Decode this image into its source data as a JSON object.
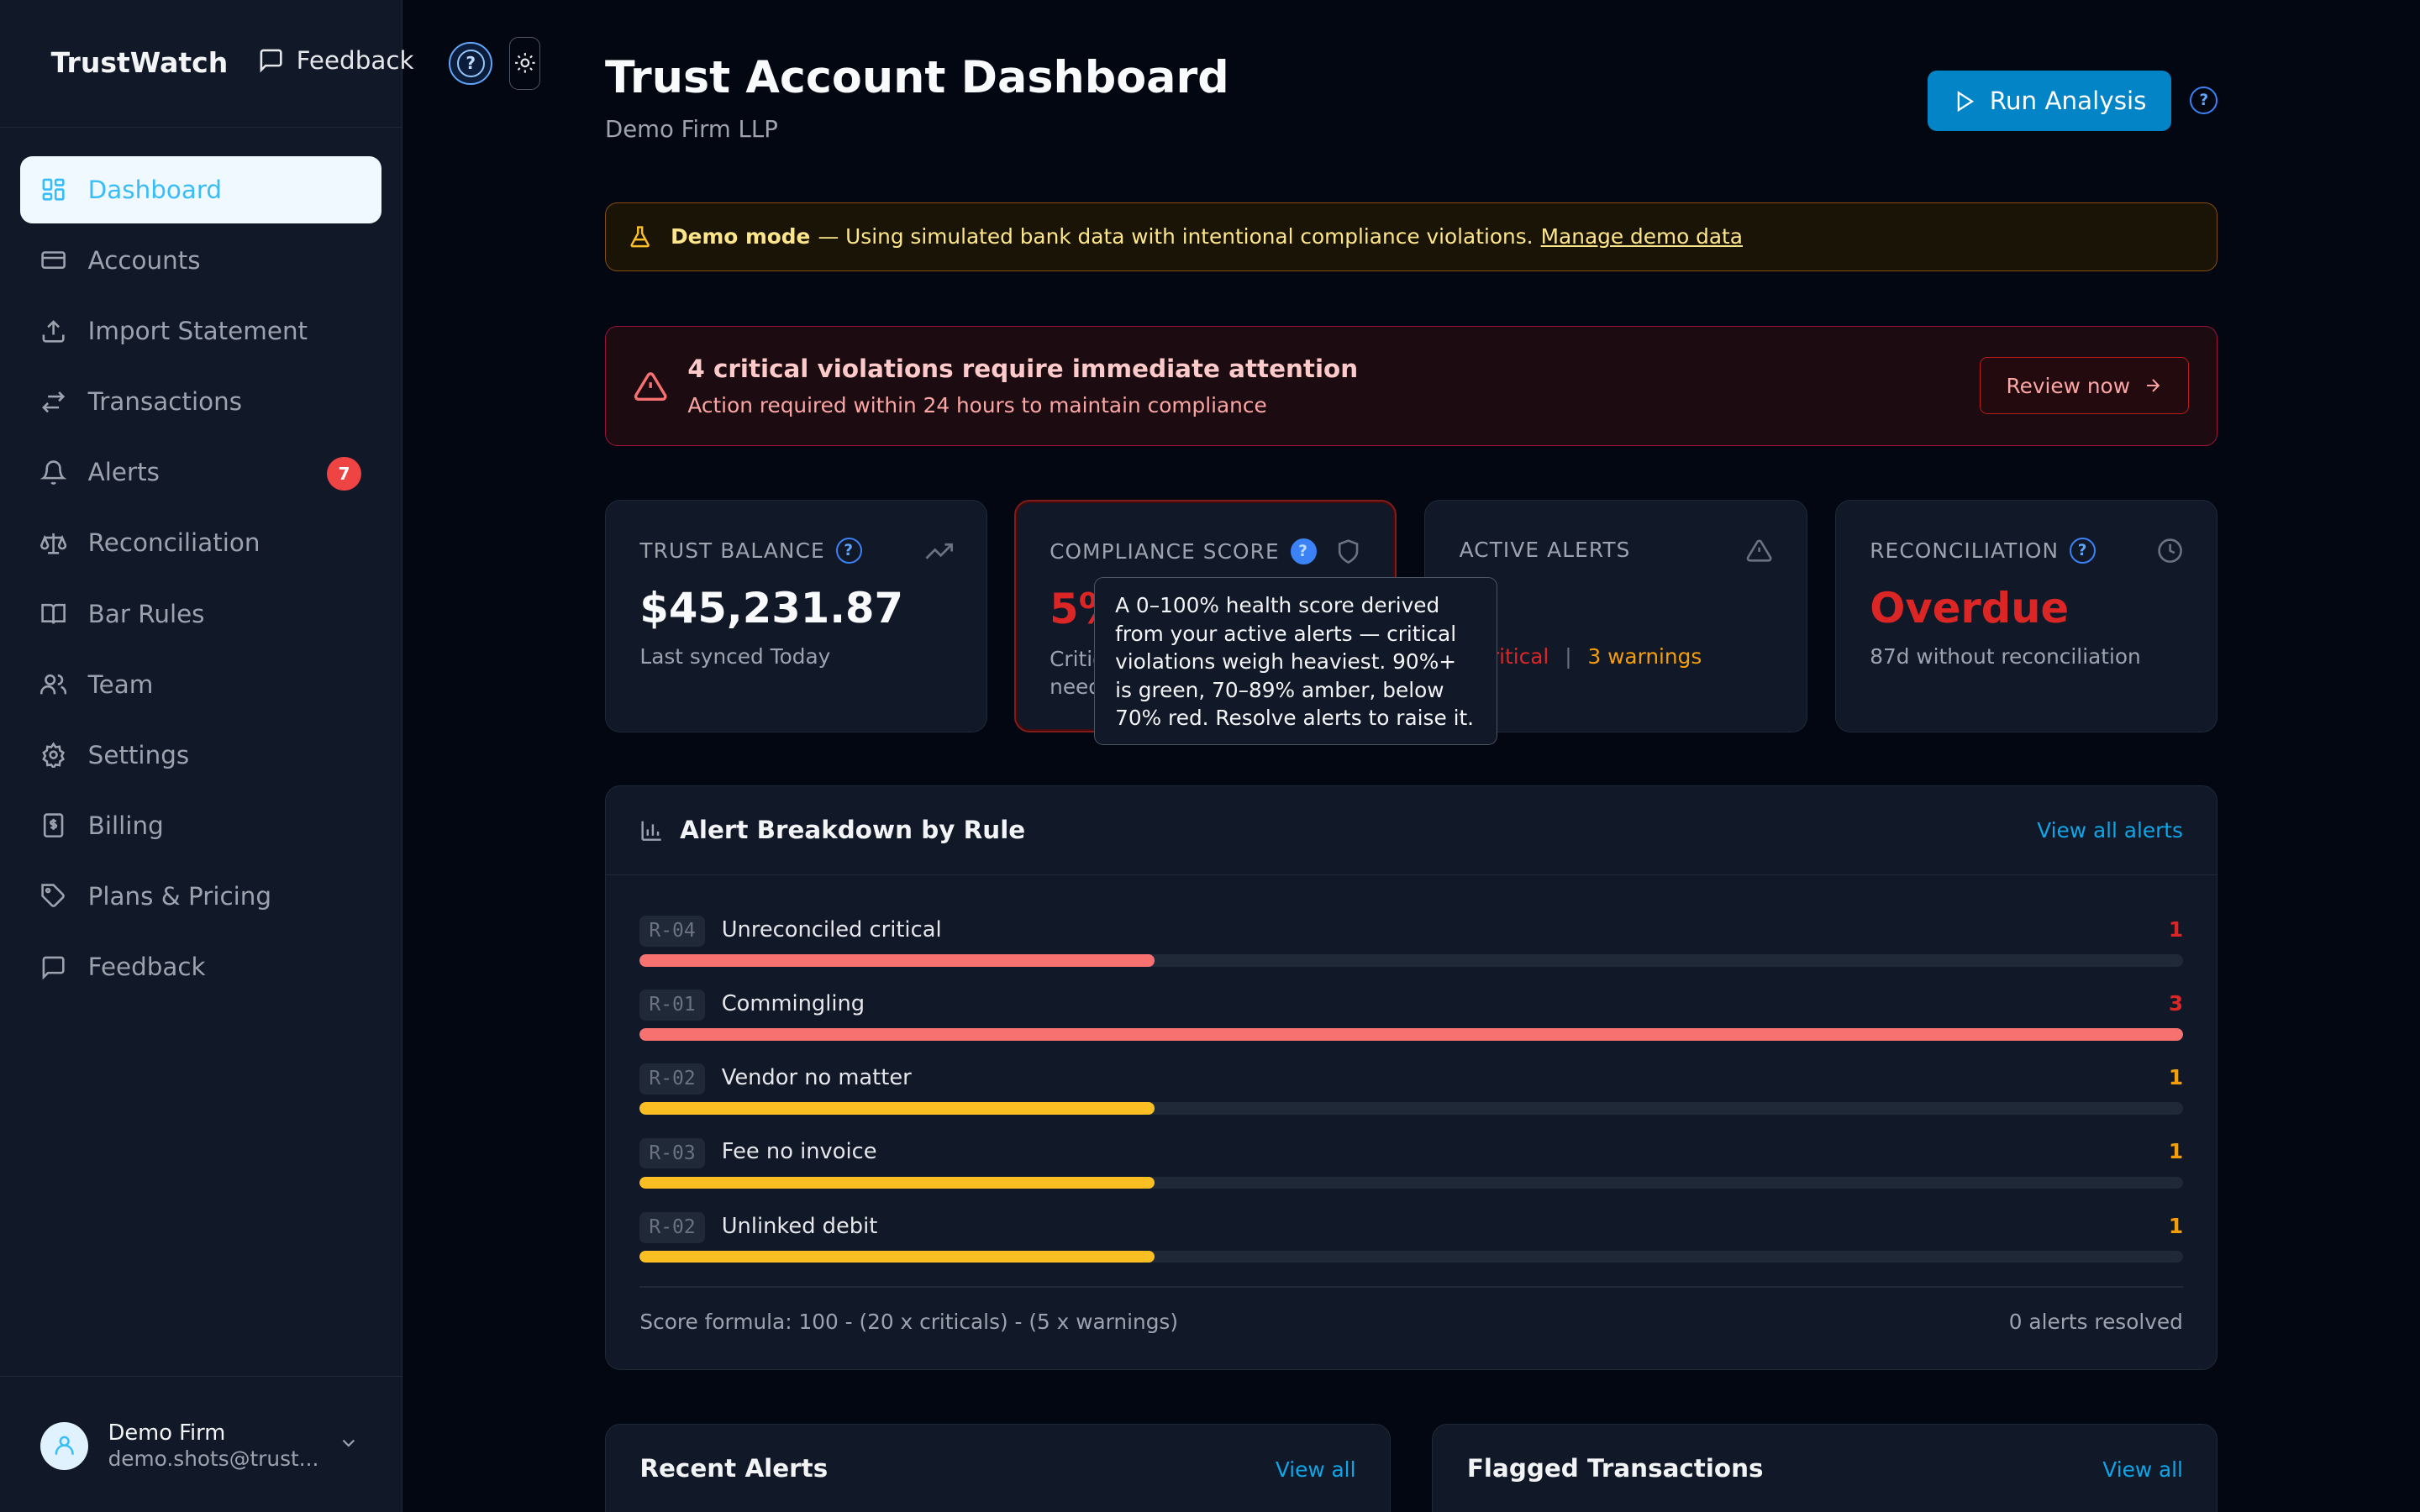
{
  "app": {
    "brand": "TrustWatch",
    "feedback_label": "Feedback"
  },
  "sidebar": {
    "items": [
      {
        "label": "Dashboard",
        "icon": "dashboard-icon",
        "active": true
      },
      {
        "label": "Accounts",
        "icon": "credit-card-icon"
      },
      {
        "label": "Import Statement",
        "icon": "upload-icon"
      },
      {
        "label": "Transactions",
        "icon": "arrows-swap-icon"
      },
      {
        "label": "Alerts",
        "icon": "bell-icon",
        "badge": "7"
      },
      {
        "label": "Reconciliation",
        "icon": "scale-icon"
      },
      {
        "label": "Bar Rules",
        "icon": "book-icon"
      },
      {
        "label": "Team",
        "icon": "users-icon"
      },
      {
        "label": "Settings",
        "icon": "gear-icon"
      },
      {
        "label": "Billing",
        "icon": "receipt-icon"
      },
      {
        "label": "Plans & Pricing",
        "icon": "tag-icon"
      },
      {
        "label": "Feedback",
        "icon": "message-icon"
      }
    ],
    "user": {
      "name": "Demo Firm",
      "email": "demo.shots@trust..."
    }
  },
  "header": {
    "title": "Trust Account Dashboard",
    "subtitle": "Demo Firm LLP",
    "run_label": "Run Analysis",
    "help_mark": "?"
  },
  "demo_banner": {
    "bold": "Demo mode",
    "text": "— Using simulated bank data with intentional compliance violations.",
    "link": "Manage demo data"
  },
  "critical_banner": {
    "title": "4 critical violations require immediate attention",
    "subtitle": "Action required within 24 hours to maintain compliance",
    "button": "Review now"
  },
  "cards": {
    "trust_balance": {
      "label": "TRUST BALANCE",
      "value": "$45,231.87",
      "sub": "Last synced Today"
    },
    "compliance": {
      "label": "COMPLIANCE SCORE",
      "value": "5%",
      "sub_line1": "Critical — action",
      "sub_line2": "needed"
    },
    "active_alerts": {
      "label": "ACTIVE ALERTS",
      "critical": "4 critical",
      "separator": "|",
      "warnings": "3 warnings"
    },
    "reconciliation": {
      "label": "RECONCILIATION",
      "value": "Overdue",
      "sub": "87d without reconciliation"
    }
  },
  "tooltip": {
    "text": "A 0–100% health score derived from your active alerts — critical violations weigh heaviest. 90%+ is green, 70–89% amber, below 70% red. Resolve alerts to raise it."
  },
  "breakdown": {
    "title": "Alert Breakdown by Rule",
    "link": "View all alerts",
    "max_count": 3,
    "rules": [
      {
        "code": "R-04",
        "name": "Unreconciled critical",
        "count": 1,
        "severity": "critical"
      },
      {
        "code": "R-01",
        "name": "Commingling",
        "count": 3,
        "severity": "critical"
      },
      {
        "code": "R-02",
        "name": "Vendor no matter",
        "count": 1,
        "severity": "warning"
      },
      {
        "code": "R-03",
        "name": "Fee no invoice",
        "count": 1,
        "severity": "warning"
      },
      {
        "code": "R-02",
        "name": "Unlinked debit",
        "count": 1,
        "severity": "warning"
      }
    ],
    "formula": "Score formula: 100 - (20 x criticals) - (5 x warnings)",
    "resolved": "0 alerts resolved"
  },
  "recent_alerts": {
    "title": "Recent Alerts",
    "link": "View all"
  },
  "flagged": {
    "title": "Flagged Transactions",
    "link": "View all"
  },
  "colors": {
    "accent": "#0284c7",
    "critical": "#dc2626",
    "critical_bar": "#f87171",
    "warning_text": "#f59e0b",
    "warning_bar": "#fbbf24"
  }
}
